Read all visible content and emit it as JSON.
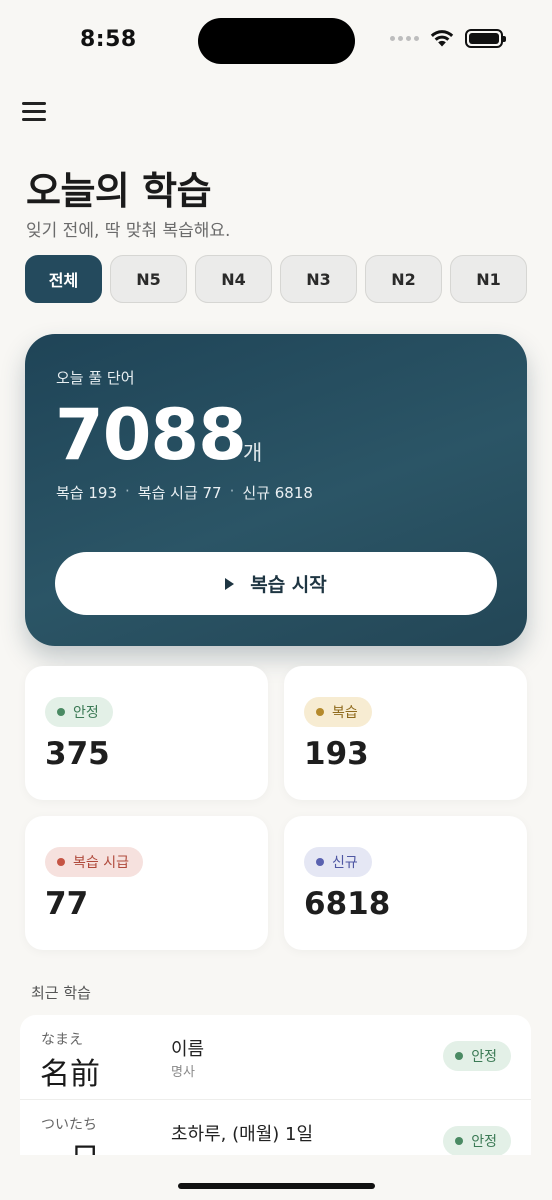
{
  "status": {
    "time": "8:58"
  },
  "header": {
    "title": "오늘의 학습",
    "subtitle": "잊기 전에, 딱 맞춰 복습해요."
  },
  "levels": [
    "전체",
    "N5",
    "N4",
    "N3",
    "N2",
    "N1"
  ],
  "selected_level": "전체",
  "hero": {
    "label": "오늘 풀 단어",
    "count": "7088",
    "unit": "개",
    "breakdown": [
      "복습 193",
      "복습 시급 77",
      "신규 6818"
    ],
    "start_label": "복습 시작"
  },
  "stats": [
    {
      "label": "안정",
      "value": "375",
      "color": "#4a8a63"
    },
    {
      "label": "복습",
      "value": "193",
      "color": "#b58a2c"
    },
    {
      "label": "복습 시급",
      "value": "77",
      "color": "#c55444"
    },
    {
      "label": "신규",
      "value": "6818",
      "color": "#5a62b0"
    }
  ],
  "recent": {
    "title": "최근 학습",
    "items": [
      {
        "reading": "なまえ",
        "word": "名前",
        "meaning": "이름",
        "pos": "명사",
        "status": "안정"
      },
      {
        "reading": "ついたち",
        "word": "一日",
        "meaning": "초하루, (매월) 1일",
        "pos": "",
        "status": "안정"
      }
    ]
  },
  "icons": {
    "menu": "hamburger-icon",
    "play": "play-icon"
  }
}
